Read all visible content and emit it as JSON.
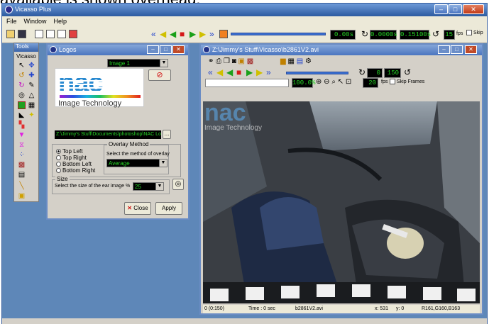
{
  "overhead_text": "available is shown overhead.",
  "app": {
    "title": "Vicasso Plus",
    "menu": [
      "File",
      "Window",
      "Help"
    ],
    "time_display": "0.00s",
    "start_time": "0.0000s",
    "end_time": "0.15100s",
    "fps": "15",
    "fps_label": "fps",
    "skip_label": "Skip"
  },
  "tools": {
    "title": "Tools",
    "label": "Vicasso"
  },
  "logos": {
    "title": "Logos",
    "image_select": "Image 1",
    "logo_word": "nac",
    "logo_tagline": "Image Technology",
    "path": "Z:\\Jimmy's Stuff\\Documents\\photoshop\\NAC Logo",
    "browse_label": "...",
    "position_options": [
      "Top Left",
      "Top Right",
      "Bottom Left",
      "Bottom Right"
    ],
    "position_selected": 0,
    "overlay_group": "Overlay Method",
    "overlay_prompt": "Select the method of overlay",
    "overlay_value": "Average",
    "size_group": "Size",
    "size_prompt": "Select the size of the ear image %",
    "size_value": "25",
    "close_label": "Close",
    "apply_label": "Apply"
  },
  "video": {
    "title": "Z:\\Jimmy's Stuff\\Vicasso\\b2861V2.avi",
    "frame_start": "0",
    "frame_end": "150",
    "zoom": "100.0%",
    "fps": "20",
    "fps_label": "fps",
    "skip_frames_label": "Skip Frames",
    "overlay_word": "nac",
    "overlay_tagline": "Image Technology",
    "status": {
      "frame": "0 (0:150)",
      "time": "Time : 0 sec",
      "file": "b2861V2.avi",
      "x": "x: 531",
      "y": "y: 0",
      "rgb": "R161,G160,B163"
    }
  },
  "colors": {
    "lcd_bg": "#000000",
    "lcd_fg": "#26d526",
    "workspace": "#5e87b8",
    "nac_blue": "#2a8ad0"
  }
}
